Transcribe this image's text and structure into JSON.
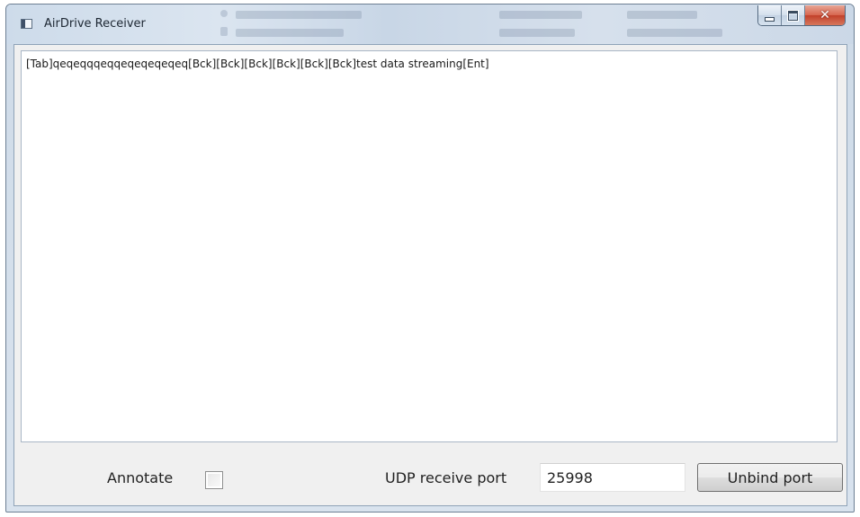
{
  "window": {
    "title": "AirDrive Receiver",
    "icon": "window-app-icon",
    "caption_buttons": {
      "minimize_icon": "minimize-icon",
      "maximize_icon": "maximize-icon",
      "close_glyph": "✕"
    }
  },
  "output": {
    "text": "[Tab]qeqeqqqeqqeqeqeqeqeq[Bck][Bck][Bck][Bck][Bck][Bck]test data streaming[Ent]"
  },
  "controls": {
    "annotate_label": "Annotate",
    "annotate_checked": false,
    "udp_label": "UDP receive port",
    "port_value": "25998",
    "unbind_label": "Unbind port"
  },
  "colors": {
    "close_button": "#c9503a",
    "title_bar": "#d3dfec",
    "client_background": "#f0f0f0"
  }
}
